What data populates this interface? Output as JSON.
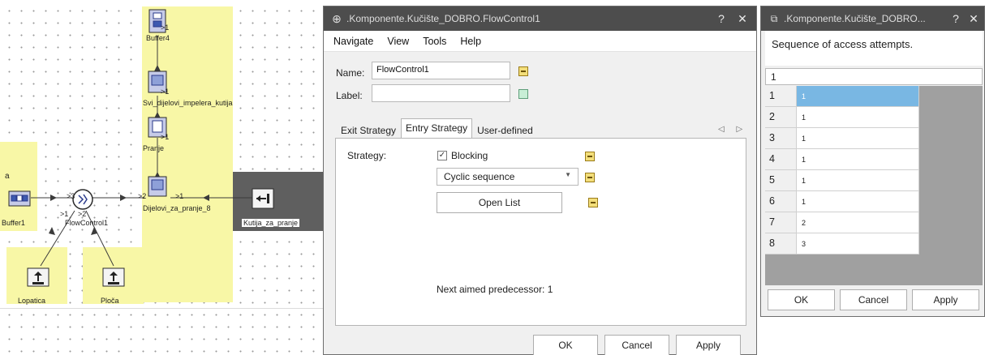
{
  "canvas": {
    "objects": {
      "buffer4": "Buffer4",
      "svi_dijelovi": "Svi_dijelovi_impelera_kutija",
      "pranje": "Pranje",
      "dijelovi": "Dijelovi_za_pranje_8",
      "kutija": "Kutija_za_pranje",
      "buffer1": "Buffer1",
      "flowcontrol": "FlowControl1",
      "lopatica": "Lopatica",
      "ploca": "Ploča",
      "left_a": "a"
    },
    "ports": {
      "p_buffer4": ">1",
      "p_svi": ">1",
      "p_pranje": ">1",
      "p_dij_2": ">2",
      "p_dij_1": ">1",
      "p_fc_3": ">3",
      "p_fc_1": ">1",
      "p_fc_2": ">2"
    }
  },
  "flow_dialog": {
    "title": ".Komponente.Kučište_DOBRO.FlowControl1",
    "help": "?",
    "close": "✕",
    "menu": [
      "Navigate",
      "View",
      "Tools",
      "Help"
    ],
    "name_label": "Name:",
    "name_value": "FlowControl1",
    "label_label": "Label:",
    "label_value": "",
    "tabs": [
      "Exit Strategy",
      "Entry Strategy",
      "User-defined"
    ],
    "active_tab": 1,
    "tab_arrows": "◁ ▷",
    "strategy_label": "Strategy:",
    "blocking_label": "Blocking",
    "blocking_checked": true,
    "strategy_value": "Cyclic sequence",
    "open_list": "Open List",
    "next_aimed": "Next aimed predecessor: 1",
    "ok": "OK",
    "cancel": "Cancel",
    "apply": "Apply"
  },
  "seq_dialog": {
    "title": ".Komponente.Kučište_DOBRO...",
    "help": "?",
    "close": "✕",
    "description": "Sequence of access attempts.",
    "count": "1",
    "rows": [
      {
        "index": "1",
        "value": "1"
      },
      {
        "index": "2",
        "value": "1"
      },
      {
        "index": "3",
        "value": "1"
      },
      {
        "index": "4",
        "value": "1"
      },
      {
        "index": "5",
        "value": "1"
      },
      {
        "index": "6",
        "value": "1"
      },
      {
        "index": "7",
        "value": "2"
      },
      {
        "index": "8",
        "value": "3"
      }
    ],
    "selected_row": 0,
    "ok": "OK",
    "cancel": "Cancel",
    "apply": "Apply"
  }
}
